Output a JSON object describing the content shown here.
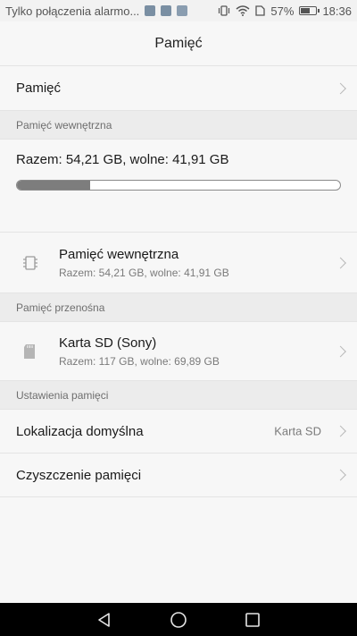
{
  "status_bar": {
    "carrier_text": "Tylko połączenia alarmo...",
    "battery_percent": "57%",
    "time": "18:36"
  },
  "header": {
    "title": "Pamięć"
  },
  "main": {
    "storage_row_label": "Pamięć",
    "internal_section": {
      "header": "Pamięć wewnętrzna",
      "summary": "Razem: 54,21 GB, wolne: 41,91 GB",
      "used_fraction": 0.227,
      "item": {
        "title": "Pamięć wewnętrzna",
        "subtitle": "Razem: 54,21 GB, wolne: 41,91 GB",
        "icon": "chip-icon"
      }
    },
    "portable_section": {
      "header": "Pamięć przenośna",
      "item": {
        "title": "Karta SD (Sony)",
        "subtitle": "Razem: 117 GB, wolne: 69,89 GB",
        "icon": "sd-card-icon"
      }
    },
    "settings_section": {
      "header": "Ustawienia pamięci",
      "default_location_label": "Lokalizacja domyślna",
      "default_location_value": "Karta SD",
      "cleanup_label": "Czyszczenie pamięci"
    }
  },
  "nav_bar": {
    "back_icon": "back-triangle-icon",
    "home_icon": "home-circle-icon",
    "recents_icon": "recents-square-icon"
  },
  "colors": {
    "progress_fill": "#7d7d7d",
    "background": "#f7f7f7",
    "section_bg": "#ececec"
  }
}
